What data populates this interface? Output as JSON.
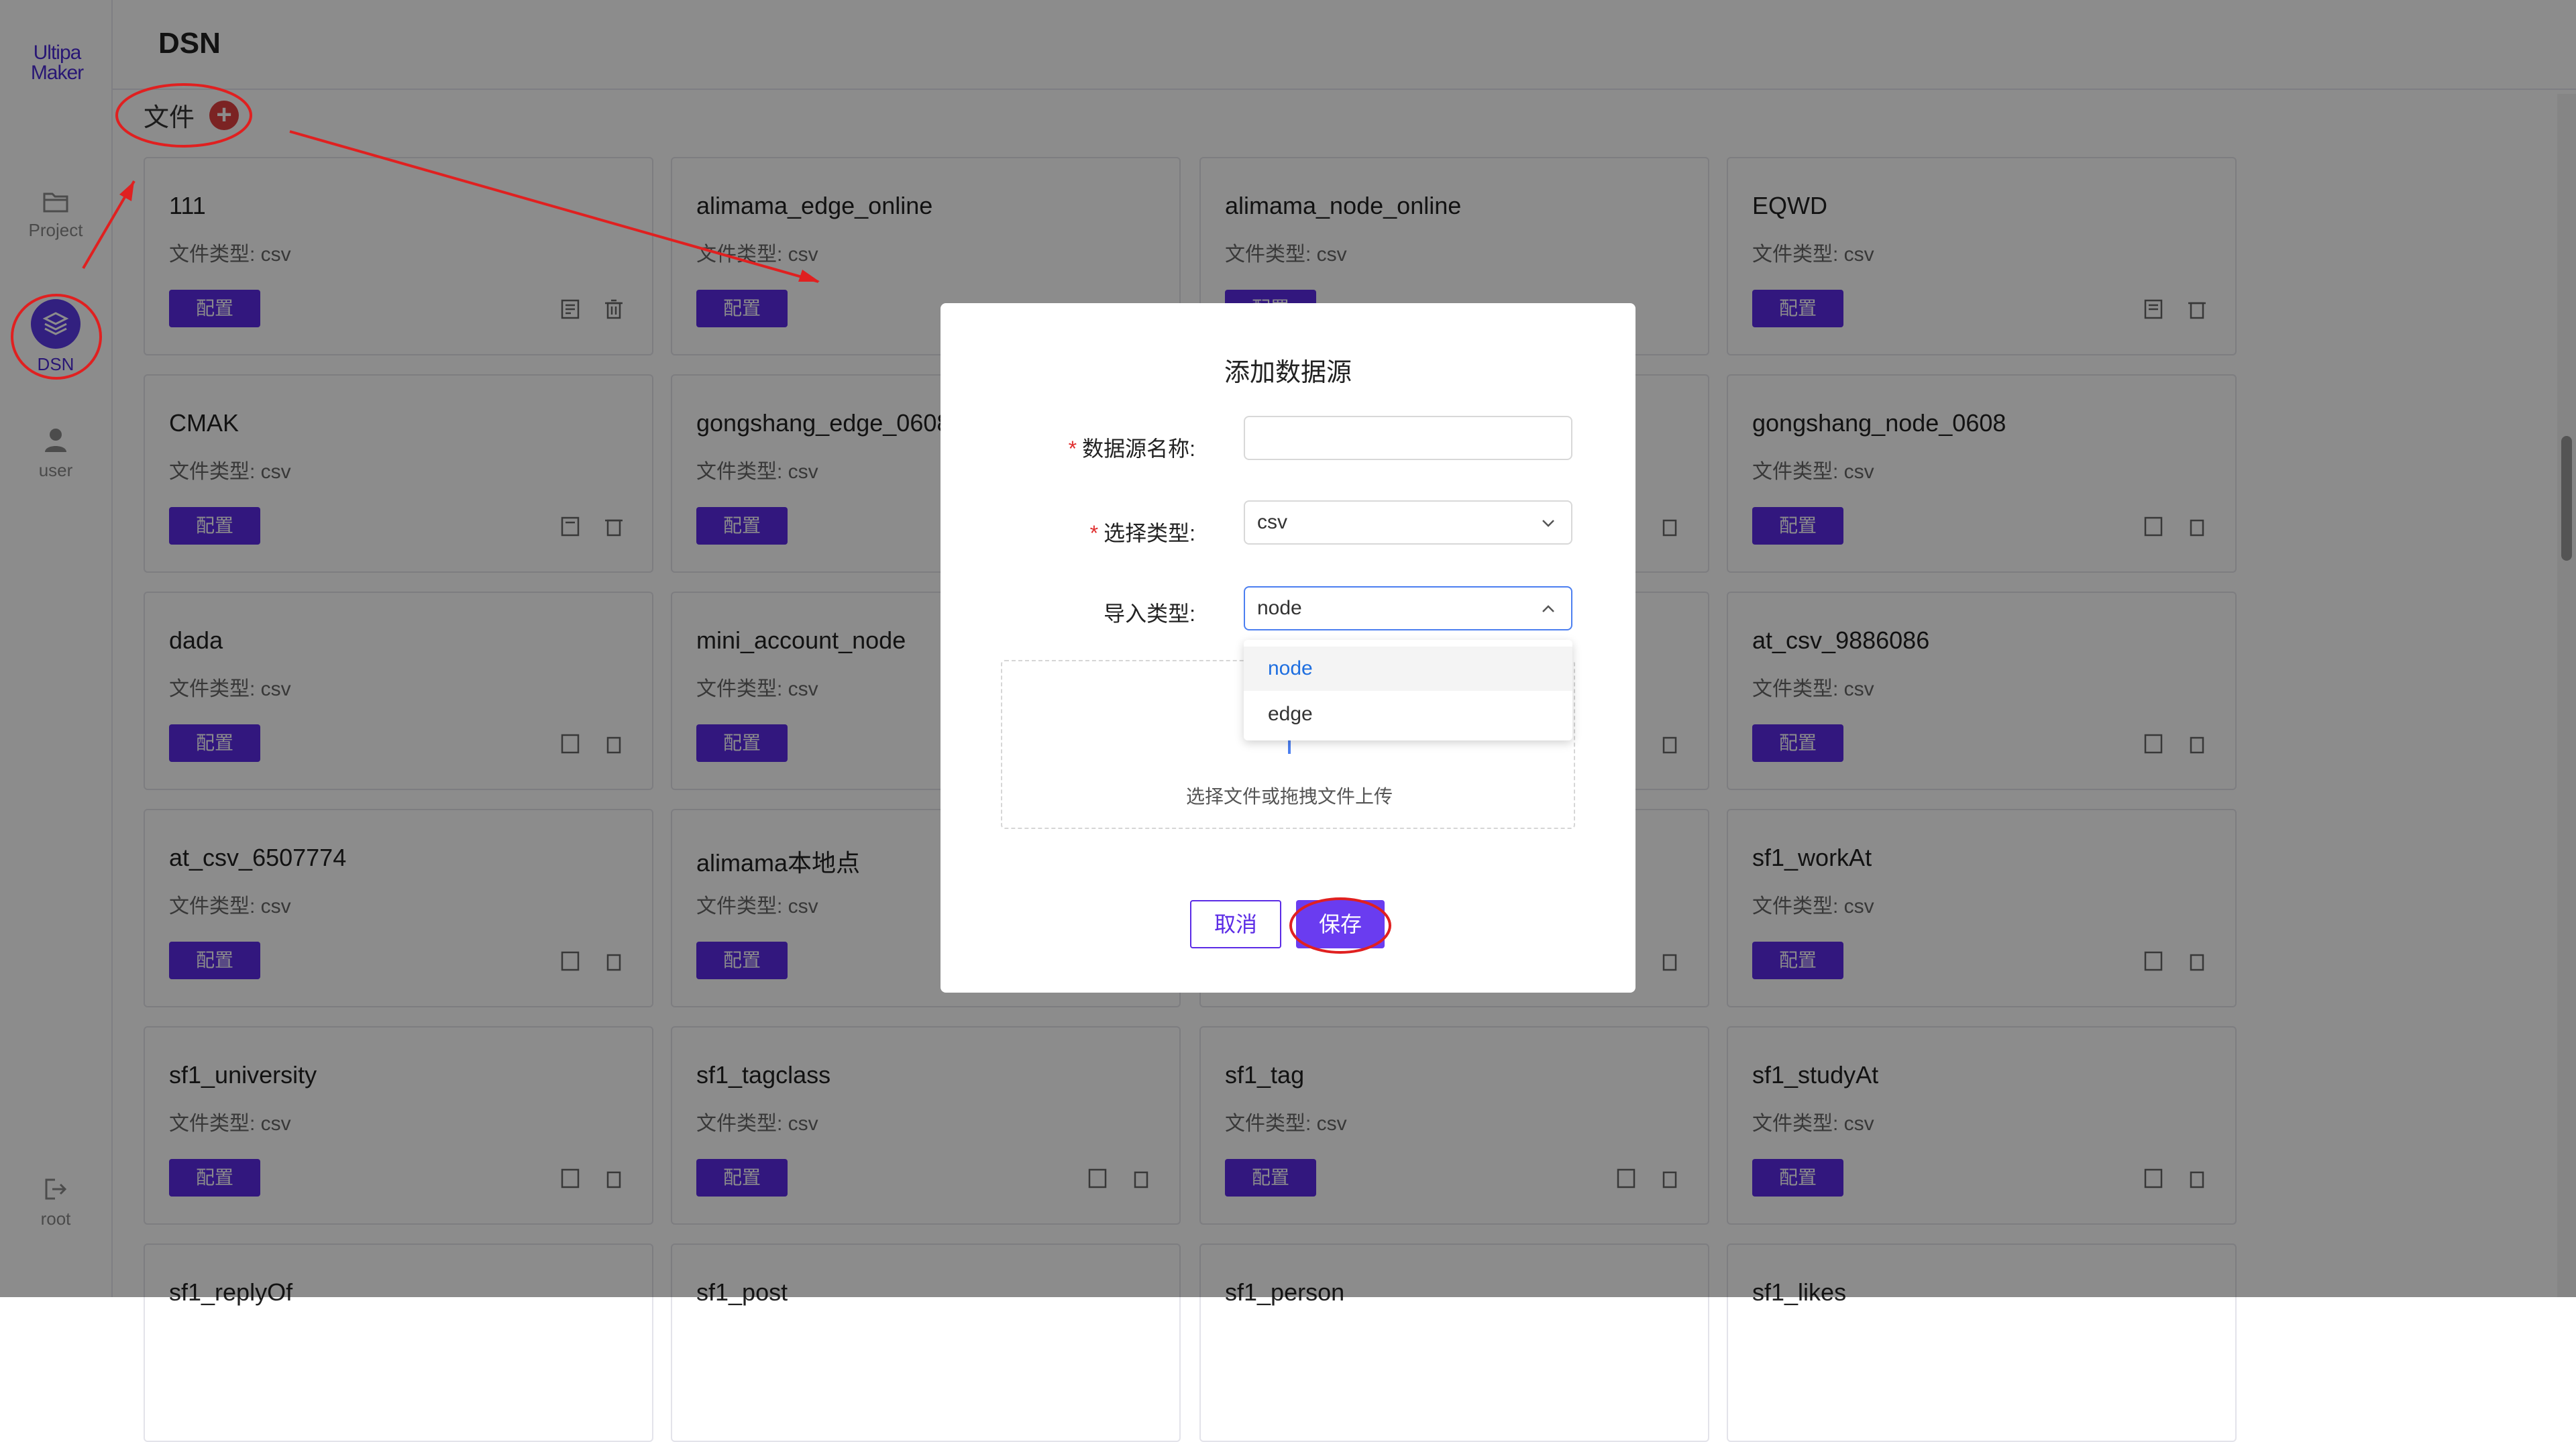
{
  "sidebar": {
    "logo": "Ultipa Maker",
    "items": [
      {
        "label": "Project",
        "icon": "folder-icon"
      },
      {
        "label": "DSN",
        "icon": "layers-icon"
      },
      {
        "label": "user",
        "icon": "user-icon"
      }
    ],
    "bottom": {
      "label": "root",
      "icon": "logout-icon"
    }
  },
  "header": {
    "title": "DSN"
  },
  "files": {
    "label": "文件",
    "add_icon": "plus-circle-icon"
  },
  "cards": [
    {
      "name": "111",
      "type": "文件类型: csv",
      "config": "配置"
    },
    {
      "name": "alimama_edge_online",
      "type": "文件类型: csv",
      "config": "配置"
    },
    {
      "name": "alimama_node_online",
      "type": "文件类型: csv",
      "config": "配置"
    },
    {
      "name": "EQWD",
      "type": "文件类型: csv",
      "config": "配置"
    },
    {
      "name": "CMAK",
      "type": "文件类型: csv",
      "config": "配置"
    },
    {
      "name": "gongshang_edge_0608",
      "type": "文件类型: csv",
      "config": "配置"
    },
    {
      "name": "",
      "type": "",
      "config": ""
    },
    {
      "name": "gongshang_node_0608",
      "type": "文件类型: csv",
      "config": "配置"
    },
    {
      "name": "dada",
      "type": "文件类型: csv",
      "config": "配置"
    },
    {
      "name": "mini_account_node",
      "type": "文件类型: csv",
      "config": "配置"
    },
    {
      "name": "",
      "type": "",
      "config": ""
    },
    {
      "name": "at_csv_9886086",
      "type": "文件类型: csv",
      "config": "配置"
    },
    {
      "name": "at_csv_6507774",
      "type": "文件类型: csv",
      "config": "配置"
    },
    {
      "name": "alimama本地点",
      "type": "文件类型: csv",
      "config": "配置"
    },
    {
      "name": "",
      "type": "",
      "config": ""
    },
    {
      "name": "sf1_workAt",
      "type": "文件类型: csv",
      "config": "配置"
    },
    {
      "name": "sf1_university",
      "type": "文件类型: csv",
      "config": "配置"
    },
    {
      "name": "sf1_tagclass",
      "type": "文件类型: csv",
      "config": "配置"
    },
    {
      "name": "sf1_tag",
      "type": "文件类型: csv",
      "config": "配置"
    },
    {
      "name": "sf1_studyAt",
      "type": "文件类型: csv",
      "config": "配置"
    },
    {
      "name": "sf1_replyOf",
      "type": "",
      "config": ""
    },
    {
      "name": "sf1_post",
      "type": "",
      "config": ""
    },
    {
      "name": "sf1_person",
      "type": "",
      "config": ""
    },
    {
      "name": "sf1_likes",
      "type": "",
      "config": ""
    }
  ],
  "modal": {
    "title": "添加数据源",
    "name_label": "数据源名称:",
    "name_value": "",
    "type_label": "选择类型:",
    "type_value": "csv",
    "import_label": "导入类型:",
    "import_value": "node",
    "import_options": [
      "node",
      "edge"
    ],
    "upload_text": "选择文件或拖拽文件上传",
    "cancel": "取消",
    "save": "保存",
    "required_mark": "*"
  },
  "colors": {
    "accent": "#5b2be6",
    "annotation": "#e02020",
    "link_blue": "#1f6fe0"
  }
}
